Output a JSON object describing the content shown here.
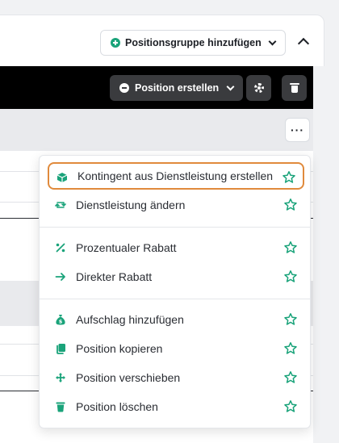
{
  "header": {
    "add_group_label": "Positionsgruppe hinzufügen",
    "icons": {
      "add": "plus-circle-icon",
      "collapse": "chevron-up-icon"
    }
  },
  "toolbar": {
    "create_position_label": "Position erstellen",
    "icons": {
      "create": "minus-circle-icon",
      "settings": "gear-icon",
      "delete": "trash-icon"
    }
  },
  "more_button_label": "···",
  "colors": {
    "accent": "#1aa37a",
    "highlight_border": "#e08a3c",
    "dark_bar": "#000000"
  },
  "menu": {
    "items": [
      {
        "label": "Kontingent aus Dienstleistung erstellen",
        "icon": "cube-icon",
        "highlighted": true
      },
      {
        "label": "Dienstleistung ändern",
        "icon": "swap-arrows-icon"
      },
      {
        "label": "Prozentualer Rabatt",
        "icon": "percent-icon"
      },
      {
        "label": "Direkter Rabatt",
        "icon": "arrow-right-icon"
      },
      {
        "label": "Aufschlag hinzufügen",
        "icon": "money-bag-icon"
      },
      {
        "label": "Position kopieren",
        "icon": "copy-icon"
      },
      {
        "label": "Position verschieben",
        "icon": "move-icon"
      },
      {
        "label": "Position löschen",
        "icon": "trash-icon"
      }
    ]
  }
}
